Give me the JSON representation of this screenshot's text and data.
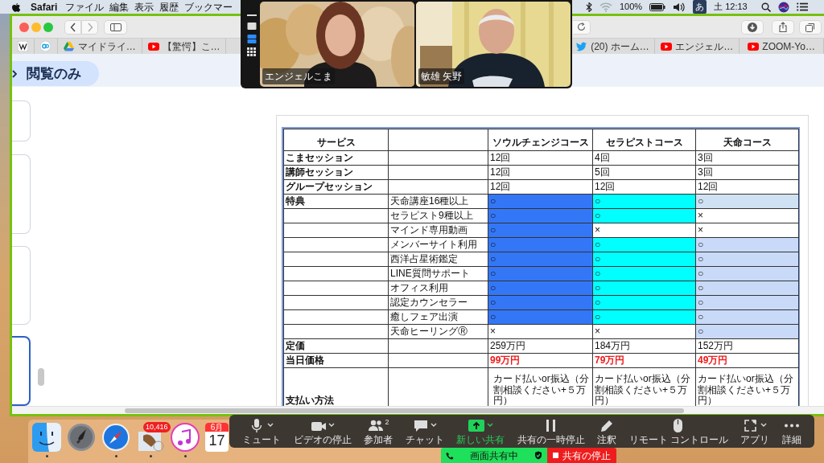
{
  "menubar": {
    "app": "Safari",
    "menus": [
      "ファイル",
      "編集",
      "表示",
      "履歴",
      "ブックマー"
    ],
    "battery": "100%",
    "input_method": "あ",
    "clock": "土 12:13"
  },
  "browser": {
    "bookmarks": [
      "マイドライ…",
      "【驚愕】こ…",
      "(20) ホーム…",
      "エンジェル…",
      "ZOOM-Yo…"
    ],
    "mode_label": "閲覧のみ"
  },
  "table": {
    "columns": [
      "サービス",
      "",
      "ソウルチェンジコース",
      "セラピストコース",
      "天命コース"
    ],
    "rows": [
      {
        "cells": [
          {
            "text": "こまセッション"
          },
          {
            "text": ""
          },
          {
            "text": "12回"
          },
          {
            "text": "4回"
          },
          {
            "text": "3回"
          }
        ]
      },
      {
        "cells": [
          {
            "text": "講師セッション"
          },
          {
            "text": ""
          },
          {
            "text": "12回"
          },
          {
            "text": "5回"
          },
          {
            "text": "3回"
          }
        ]
      },
      {
        "cells": [
          {
            "text": "グループセッション"
          },
          {
            "text": ""
          },
          {
            "text": "12回"
          },
          {
            "text": "12回"
          },
          {
            "text": "12回"
          }
        ]
      },
      {
        "cells": [
          {
            "text": "特典"
          },
          {
            "text": "天命講座16種以上"
          },
          {
            "text": "○",
            "color": "#3477f6"
          },
          {
            "text": "○",
            "color": "#00ffff"
          },
          {
            "text": "○",
            "color": "#cfe2f3"
          }
        ]
      },
      {
        "cells": [
          {
            "text": ""
          },
          {
            "text": "セラピスト9種以上"
          },
          {
            "text": "○",
            "color": "#3477f6"
          },
          {
            "text": "○",
            "color": "#00ffff"
          },
          {
            "text": "×"
          }
        ]
      },
      {
        "cells": [
          {
            "text": ""
          },
          {
            "text": "マインド専用動画"
          },
          {
            "text": "○",
            "color": "#3477f6"
          },
          {
            "text": "×"
          },
          {
            "text": "×"
          }
        ]
      },
      {
        "cells": [
          {
            "text": ""
          },
          {
            "text": "メンバーサイト利用"
          },
          {
            "text": "○",
            "color": "#3477f6"
          },
          {
            "text": "○",
            "color": "#00ffff"
          },
          {
            "text": "○",
            "color": "#c9daf8"
          }
        ]
      },
      {
        "cells": [
          {
            "text": ""
          },
          {
            "text": "西洋占星術鑑定"
          },
          {
            "text": "○",
            "color": "#3477f6"
          },
          {
            "text": "○",
            "color": "#00ffff"
          },
          {
            "text": "○",
            "color": "#c9daf8"
          }
        ]
      },
      {
        "cells": [
          {
            "text": ""
          },
          {
            "text": "LINE質問サポート"
          },
          {
            "text": "○",
            "color": "#3477f6"
          },
          {
            "text": "○",
            "color": "#00ffff"
          },
          {
            "text": "○",
            "color": "#c9daf8"
          }
        ]
      },
      {
        "cells": [
          {
            "text": ""
          },
          {
            "text": "オフィス利用"
          },
          {
            "text": "○",
            "color": "#3477f6"
          },
          {
            "text": "○",
            "color": "#00ffff"
          },
          {
            "text": "○",
            "color": "#c9daf8"
          }
        ]
      },
      {
        "cells": [
          {
            "text": ""
          },
          {
            "text": "認定カウンセラー"
          },
          {
            "text": "○",
            "color": "#3477f6"
          },
          {
            "text": "○",
            "color": "#00ffff"
          },
          {
            "text": "○",
            "color": "#c9daf8"
          }
        ]
      },
      {
        "cells": [
          {
            "text": ""
          },
          {
            "text": "癒しフェア出演"
          },
          {
            "text": "○",
            "color": "#3477f6"
          },
          {
            "text": "○",
            "color": "#00ffff"
          },
          {
            "text": "○",
            "color": "#c9daf8"
          }
        ]
      },
      {
        "cells": [
          {
            "text": ""
          },
          {
            "text": "天命ヒーリングⓇ"
          },
          {
            "text": "×"
          },
          {
            "text": "×"
          },
          {
            "text": "○",
            "color": "#c9daf8"
          }
        ]
      },
      {
        "cells": [
          {
            "text": "定価"
          },
          {
            "text": ""
          },
          {
            "text": "259万円"
          },
          {
            "text": "184万円"
          },
          {
            "text": "152万円"
          }
        ]
      },
      {
        "kind": "sale",
        "cells": [
          {
            "text": "当日価格"
          },
          {
            "text": ""
          },
          {
            "text": "99万円"
          },
          {
            "text": "79万円"
          },
          {
            "text": "49万円"
          }
        ]
      },
      {
        "kind": "tall",
        "cells": [
          {
            "text": "支払い方法"
          },
          {
            "text": ""
          },
          {
            "text": "カード払いor振込（分割相談ください+５万円）"
          },
          {
            "text": "カード払いor振込（分割相談ください+５万円）"
          },
          {
            "text": "カード払いor振込（分割相談ください+５万円）"
          }
        ]
      }
    ]
  },
  "video": {
    "layouts": [
      {
        "kind": "single",
        "selected": false
      },
      {
        "kind": "strip",
        "selected": true
      },
      {
        "kind": "grid",
        "selected": false
      }
    ],
    "tiles": [
      {
        "name": "エンジェルこま",
        "kind": "picture"
      },
      {
        "name": "敏雄 矢野",
        "kind": "picture"
      }
    ]
  },
  "meeting_toolbar": [
    {
      "label": "ミュート",
      "kind": "mic",
      "caret": true,
      "highlighted": false
    },
    {
      "label": "ビデオの停止",
      "kind": "camera",
      "caret": true,
      "highlighted": false
    },
    {
      "label": "参加者",
      "kind": "people",
      "count": "2",
      "caret": false,
      "highlighted": false
    },
    {
      "label": "チャット",
      "kind": "chat",
      "caret": true,
      "highlighted": false
    },
    {
      "label": "新しい共有",
      "kind": "share",
      "caret": true,
      "highlighted": true
    },
    {
      "label": "共有の一時停止",
      "kind": "pause",
      "caret": false,
      "highlighted": false
    },
    {
      "label": "注釈",
      "kind": "pencil",
      "caret": false,
      "highlighted": false
    },
    {
      "label": "リモート コントロール",
      "kind": "mouse",
      "caret": false,
      "highlighted": false
    },
    {
      "label": "アプリ",
      "kind": "apps",
      "caret": true,
      "highlighted": false
    },
    {
      "label": "詳細",
      "kind": "more",
      "caret": false,
      "highlighted": false
    }
  ],
  "share_bar": {
    "status": "画面共有中",
    "stop": "共有の停止"
  },
  "dock": [
    {
      "kind": "finder",
      "running": true
    },
    {
      "kind": "launchpad",
      "running": false
    },
    {
      "kind": "safari",
      "running": true
    },
    {
      "kind": "mail",
      "running": true,
      "badge": "10,416"
    },
    {
      "kind": "music",
      "running": true
    },
    {
      "kind": "calendar",
      "running": false,
      "month": "6月",
      "day": "17"
    }
  ]
}
